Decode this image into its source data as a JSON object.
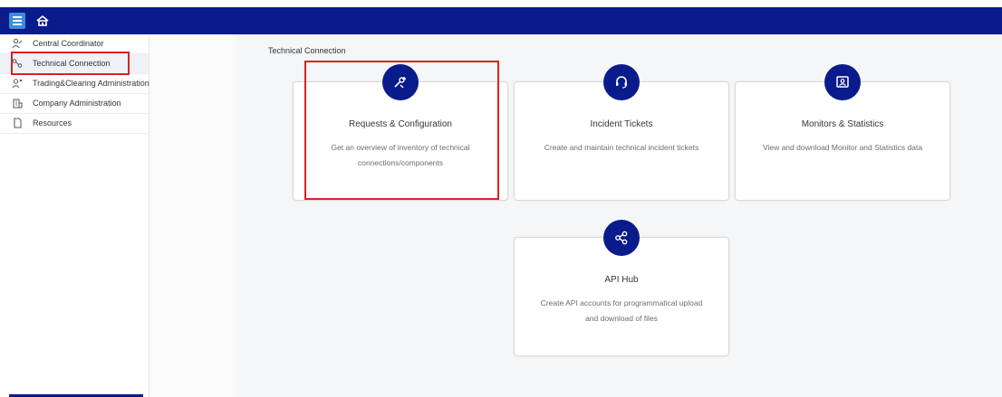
{
  "shell": {
    "menu_icon": "hamburger-menu-icon",
    "home_icon": "home-icon",
    "accent_color": "#0a1b8c"
  },
  "sidebar": {
    "items": [
      {
        "label": "Central Coordinator",
        "icon": "person-coordinator-icon"
      },
      {
        "label": "Technical Connection",
        "icon": "connection-icon"
      },
      {
        "label": "Trading&Clearing Administration",
        "icon": "user-admin-icon"
      },
      {
        "label": "Company Administration",
        "icon": "building-icon"
      },
      {
        "label": "Resources",
        "icon": "document-icon"
      }
    ]
  },
  "main": {
    "breadcrumb": "Technical Connection",
    "tiles": [
      {
        "title": "Requests & Configuration",
        "description": "Get an overview of inventory of technical connections/components",
        "icon": "tools-icon"
      },
      {
        "title": "Incident Tickets",
        "description": "Create and maintain technical incident tickets",
        "icon": "headset-icon"
      },
      {
        "title": "Monitors & Statistics",
        "description": "View and download Monitor and Statistics data",
        "icon": "monitor-icon"
      },
      {
        "title": "API Hub",
        "description": "Create API accounts for programmatical upload and download of files",
        "icon": "share-network-icon"
      }
    ]
  }
}
